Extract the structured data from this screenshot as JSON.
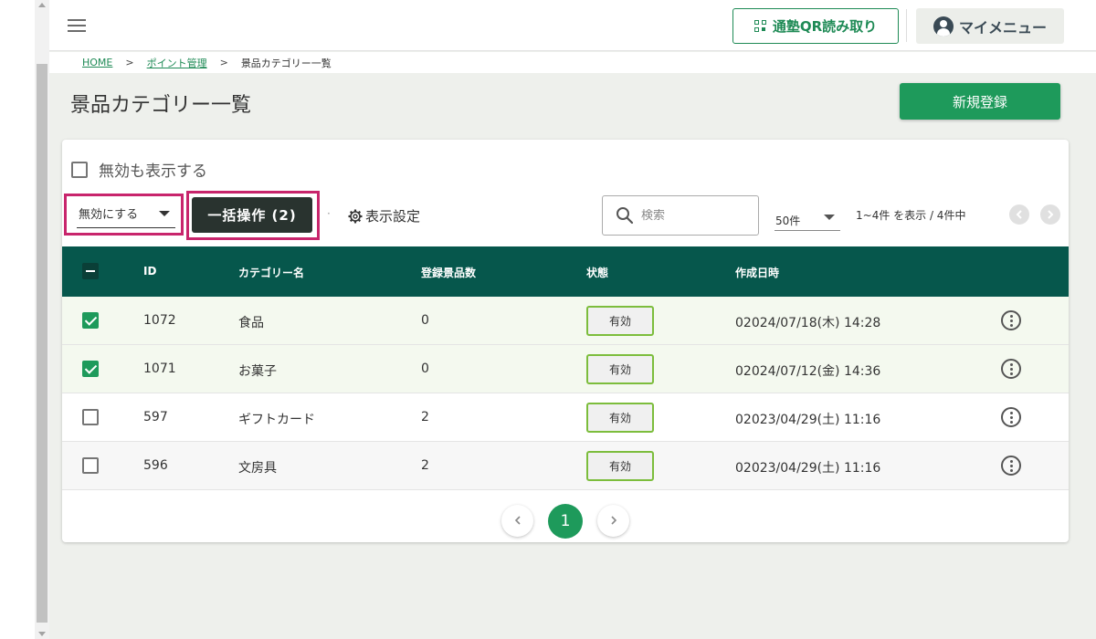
{
  "header": {
    "qr_button_label": "通塾QR読み取り",
    "my_menu_label": "マイメニュー"
  },
  "breadcrumb": {
    "home": "HOME",
    "sep1": ">",
    "points": "ポイント管理",
    "sep2": ">",
    "current": "景品カテゴリー一覧"
  },
  "page": {
    "title": "景品カテゴリー一覧",
    "new_button_label": "新規登録"
  },
  "toolbar": {
    "show_inactive_label": "無効も表示する",
    "action_select_value": "無効にする",
    "bulk_button_label": "一括操作 (2)",
    "dot": "·",
    "display_settings_label": "表示設定",
    "search_placeholder": "検索",
    "per_page_value": "50件",
    "range_text": "1~4件 を表示 / 4件中"
  },
  "table": {
    "headers": {
      "id": "ID",
      "category": "カテゴリー名",
      "count": "登録景品数",
      "status": "状態",
      "created": "作成日時"
    },
    "rows": [
      {
        "checked": true,
        "id": "1072",
        "name": "食品",
        "count": "0",
        "status": "有効",
        "created": "02024/07/18(木) 14:28"
      },
      {
        "checked": true,
        "id": "1071",
        "name": "お菓子",
        "count": "0",
        "status": "有効",
        "created": "02024/07/12(金) 14:36"
      },
      {
        "checked": false,
        "id": "597",
        "name": "ギフトカード",
        "count": "2",
        "status": "有効",
        "created": "02023/04/29(土) 11:16"
      },
      {
        "checked": false,
        "id": "596",
        "name": "文房具",
        "count": "2",
        "status": "有効",
        "created": "02023/04/29(土) 11:16"
      }
    ]
  },
  "pagination": {
    "current_page": "1"
  },
  "colors": {
    "brand_green": "#1e9a5b",
    "table_header": "#06574c",
    "highlight": "#c8256c",
    "badge_border": "#7cbd3c"
  }
}
